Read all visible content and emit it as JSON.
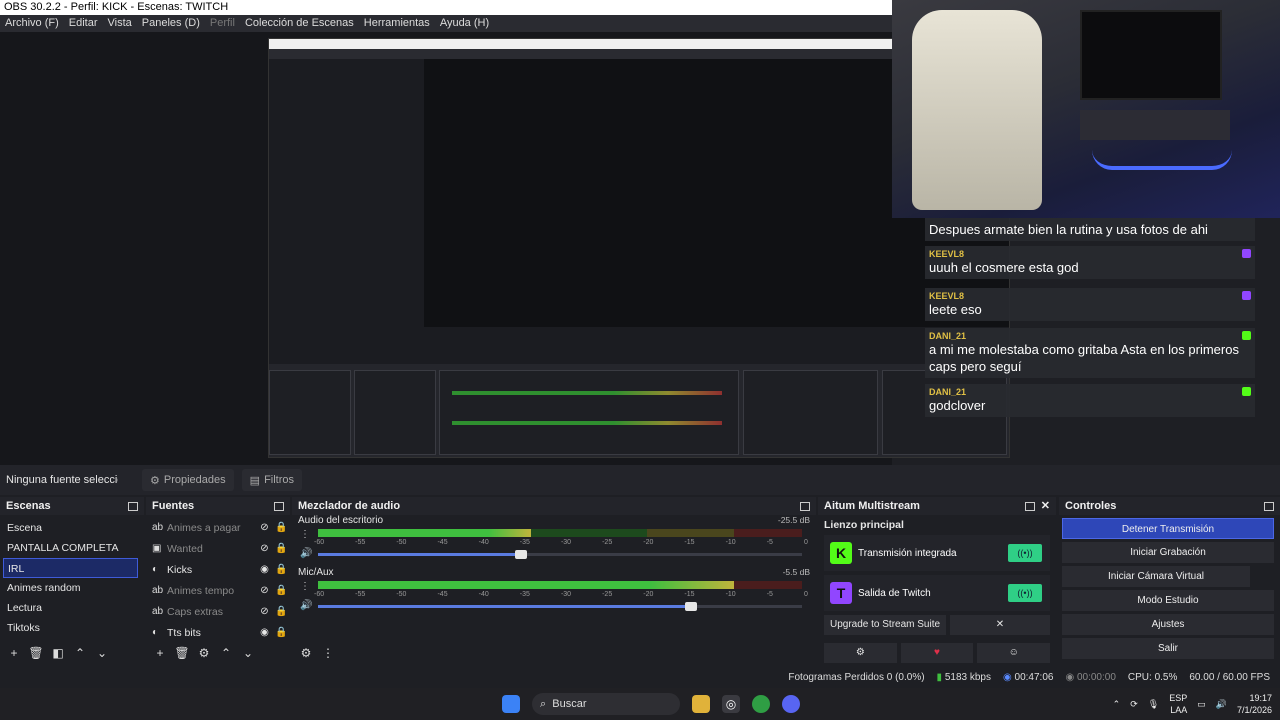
{
  "window": {
    "title": "OBS 30.2.2 - Perfil: KICK - Escenas: TWITCH"
  },
  "menu": [
    "Archivo (F)",
    "Editar",
    "Vista",
    "Paneles (D)",
    "Perfil",
    "Colección de Escenas",
    "Herramientas",
    "Ayuda (H)"
  ],
  "chat": [
    {
      "user": "",
      "text": "Despues armate bien la rutina y usa fotos de ahi"
    },
    {
      "user": "KEEVL8",
      "text": "uuuh el cosmere esta god"
    },
    {
      "user": "KEEVL8",
      "text": "leete eso"
    },
    {
      "user": "DANI_21",
      "text": "a mi me molestaba como gritaba Asta en los primeros caps pero seguí"
    },
    {
      "user": "DANI_21",
      "text": "godclover"
    }
  ],
  "sourcebar": {
    "none": "Ninguna fuente seleccionada",
    "properties": "Propiedades",
    "filters": "Filtros"
  },
  "scenes": {
    "title": "Escenas",
    "items": [
      "Escena",
      "PANTALLA COMPLETA",
      "IRL",
      "Animes random",
      "Lectura",
      "Tiktoks"
    ],
    "selected": 2
  },
  "sources": {
    "title": "Fuentes",
    "items": [
      {
        "name": "Animes a pagar",
        "icon": "ab",
        "visible": false
      },
      {
        "name": "Wanted",
        "icon": "▣",
        "visible": false
      },
      {
        "name": "Kicks",
        "icon": "◐",
        "visible": true
      },
      {
        "name": "Animes tempo",
        "icon": "ab",
        "visible": false
      },
      {
        "name": "Caps extras",
        "icon": "ab",
        "visible": false
      },
      {
        "name": "Tts bits",
        "icon": "◐",
        "visible": true
      }
    ]
  },
  "mixer": {
    "title": "Mezclador de audio",
    "scale": [
      "-60",
      "-55",
      "-50",
      "-45",
      "-40",
      "-35",
      "-30",
      "-25",
      "-20",
      "-15",
      "-10",
      "-5",
      "0"
    ],
    "channels": [
      {
        "name": "Audio del escritorio",
        "db": "-25.5 dB",
        "level": 0.44,
        "volume": 0.42
      },
      {
        "name": "Mic/Aux",
        "db": "-5.5 dB",
        "level": 0.86,
        "volume": 0.77
      }
    ]
  },
  "multistream": {
    "title": "Aitum Multistream",
    "section": "Lienzo principal",
    "outputs": [
      {
        "name": "Transmisión integrada",
        "logo": "K",
        "color": "#53fc18"
      },
      {
        "name": "Salida de Twitch",
        "logo": "T",
        "color": "#9146ff"
      }
    ],
    "upgrade": "Upgrade to Stream Suite"
  },
  "controls": {
    "title": "Controles",
    "buttons": [
      "Detener Transmisión",
      "Iniciar Grabación",
      "Iniciar Cámara Virtual",
      "Modo Estudio",
      "Ajustes",
      "Salir"
    ]
  },
  "status": {
    "dropped": "Fotogramas Perdidos 0 (0.0%)",
    "bitrate": "5183 kbps",
    "stream_time": "00:47:06",
    "rec_time": "00:00:00",
    "cpu": "CPU: 0.5%",
    "fps": "60.00 / 60.00 FPS"
  },
  "taskbar": {
    "search": "Buscar",
    "lang": "ESP",
    "lang2": "LAA",
    "time": "19:17",
    "date": "7/1/2026"
  }
}
